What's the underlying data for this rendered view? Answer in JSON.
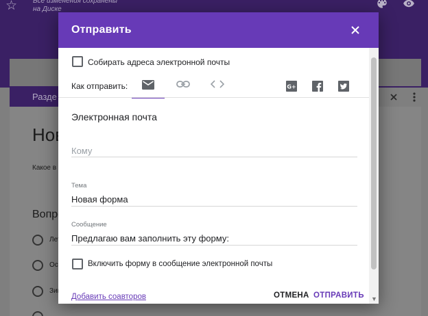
{
  "background": {
    "saved_status": "Все изменения сохранены на Диске",
    "section_label": "Разде",
    "form_title": "Нов",
    "form_description": "Какое в",
    "question_title": "Вопро",
    "options": [
      "Лет",
      "Осе",
      "Зим",
      ""
    ]
  },
  "dialog": {
    "title": "Отправить",
    "collect_emails_label": "Собирать адреса электронной почты",
    "send_via_label": "Как отправить:",
    "section_title": "Электронная почта",
    "to_placeholder": "Кому",
    "subject_label": "Тема",
    "subject_value": "Новая форма",
    "message_label": "Сообщение",
    "message_value": "Предлагаю вам заполнить эту форму:",
    "include_form_label": "Включить форму в сообщение электронной почты",
    "add_collaborators_link": "Добавить соавторов",
    "cancel_button": "ОТМЕНА",
    "send_button": "ОТПРАВИТЬ"
  },
  "colors": {
    "accent": "#673ab7",
    "header_bg_dimmed": "#3a2064"
  }
}
